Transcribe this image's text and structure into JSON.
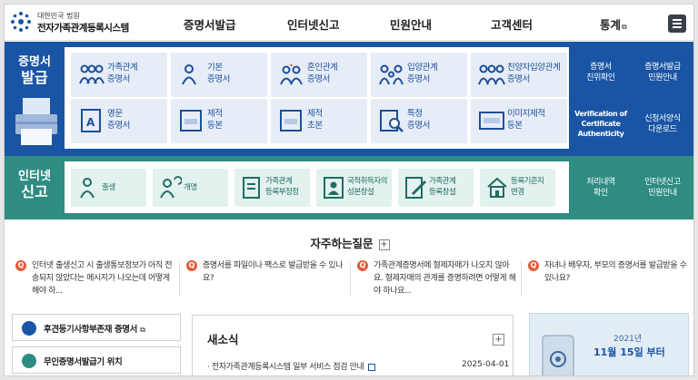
{
  "header": {
    "logo_small": "대한민국 법원",
    "logo_title": "전자가족관계등록시스템",
    "nav": [
      {
        "label": "증명서발급"
      },
      {
        "label": "인터넷신고"
      },
      {
        "label": "민원안내"
      },
      {
        "label": "고객센터"
      },
      {
        "label": "통계"
      }
    ]
  },
  "cert": {
    "band_title_1": "증명서",
    "band_title_2": "발급",
    "tiles": [
      {
        "label": "가족관계\n증명서",
        "icon": "family-icon"
      },
      {
        "label": "기본\n증명서",
        "icon": "person-icon"
      },
      {
        "label": "혼인관계\n증명서",
        "icon": "couple-icon"
      },
      {
        "label": "입양관계\n증명서",
        "icon": "adoption-icon"
      },
      {
        "label": "친양자입양관계\n증명서",
        "icon": "family-adoption-icon"
      },
      {
        "label": "영문\n증명서",
        "icon": "english-doc-icon"
      },
      {
        "label": "제적\n등본",
        "icon": "removed-register-icon"
      },
      {
        "label": "제적\n초본",
        "icon": "removed-extract-icon"
      },
      {
        "label": "특정\n증명서",
        "icon": "search-doc-icon"
      },
      {
        "label": "이미지제적\n등본",
        "icon": "image-register-icon"
      }
    ],
    "side_links": [
      {
        "label": "증명서\n진위확인"
      },
      {
        "label": "증명서발급\n민원안내"
      },
      {
        "label": "Verification of\nCertificate\nAuthenticity"
      },
      {
        "label": "신청서양식\n다운로드"
      }
    ]
  },
  "report": {
    "band_title_1": "인터넷",
    "band_title_2": "신고",
    "tiles": [
      {
        "label": "출생",
        "icon": "birth-icon"
      },
      {
        "label": "개명",
        "icon": "rename-icon"
      },
      {
        "label": "가족관계\n등록부정정",
        "icon": "register-correction-icon"
      },
      {
        "label": "국적취득자의\n성본창설",
        "icon": "nationality-icon"
      },
      {
        "label": "가족관계\n등록창설",
        "icon": "register-create-icon"
      },
      {
        "label": "등록기준지\n변경",
        "icon": "house-icon"
      }
    ],
    "side_links": [
      {
        "label": "처리내역\n확인"
      },
      {
        "label": "인터넷신고\n민원안내"
      }
    ]
  },
  "faq": {
    "title": "자주하는질문",
    "items": [
      {
        "text": "인터넷 출생신고 시 출생통보정보가 아직 전송되지 않았다는 메시지가 나오는데 어떻게 해야 하..."
      },
      {
        "text": "증명서를 파일이나 팩스로 발급받을 수 있나요?"
      },
      {
        "text": "가족관계증명서에 형제자매가 나오지 않아요. 형제자매의 관계를 증명하려면 어떻게 해야 하나요..."
      },
      {
        "text": "자녀나 배우자, 부모의 증명서를 발급받을 수 있나요?"
      }
    ]
  },
  "quick_links": [
    {
      "label": "후견등기사항부존재 증명서"
    },
    {
      "label": "무인증명서발급기 위치"
    }
  ],
  "news": {
    "title": "새소식",
    "item": "전자가족관계등록시스템 일부 서비스 점검 안내",
    "date": "2025-04-01"
  },
  "banner": {
    "year": "2021년",
    "date": "11월 15일 부터"
  },
  "colors": {
    "cert_band": "#1a55a5",
    "report_band": "#2f8c83"
  }
}
